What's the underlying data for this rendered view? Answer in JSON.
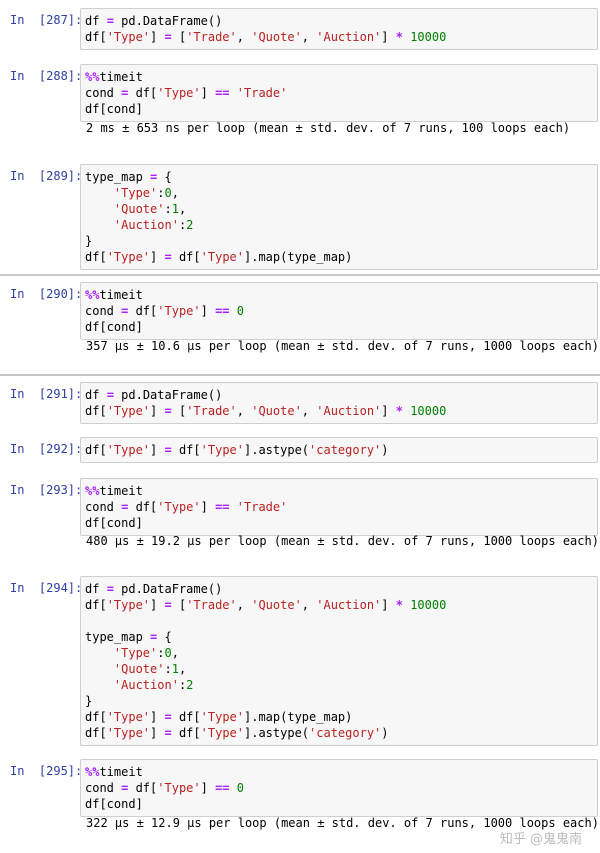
{
  "cells": [
    {
      "prompt_prefix": "In  ",
      "prompt_num": "[287]:",
      "lines": [
        [
          [
            "plain",
            "df "
          ],
          [
            "op",
            "="
          ],
          [
            "plain",
            " pd.DataFrame()"
          ]
        ],
        [
          [
            "plain",
            "df["
          ],
          [
            "str",
            "'Type'"
          ],
          [
            "plain",
            "] "
          ],
          [
            "op",
            "="
          ],
          [
            "plain",
            " ["
          ],
          [
            "str",
            "'Trade'"
          ],
          [
            "plain",
            ", "
          ],
          [
            "str",
            "'Quote'"
          ],
          [
            "plain",
            ", "
          ],
          [
            "str",
            "'Auction'"
          ],
          [
            "plain",
            "] "
          ],
          [
            "op",
            "*"
          ],
          [
            "plain",
            " "
          ],
          [
            "num",
            "10000"
          ]
        ]
      ]
    },
    {
      "prompt_prefix": "In  ",
      "prompt_num": "[288]:",
      "lines": [
        [
          [
            "kw-magic",
            "%%"
          ],
          [
            "plain",
            "timeit"
          ]
        ],
        [
          [
            "plain",
            "cond "
          ],
          [
            "op",
            "="
          ],
          [
            "plain",
            " df["
          ],
          [
            "str",
            "'Type'"
          ],
          [
            "plain",
            "] "
          ],
          [
            "op",
            "=="
          ],
          [
            "plain",
            " "
          ],
          [
            "str",
            "'Trade'"
          ]
        ],
        [
          [
            "plain",
            "df[cond]"
          ]
        ]
      ],
      "output": "2 ms ± 653 ns per loop (mean ± std. dev. of 7 runs, 100 loops each)"
    },
    {
      "prompt_prefix": "In  ",
      "prompt_num": "[289]:",
      "lines": [
        [
          [
            "plain",
            "type_map "
          ],
          [
            "op",
            "="
          ],
          [
            "plain",
            " {"
          ]
        ],
        [
          [
            "plain",
            "    "
          ],
          [
            "str",
            "'Type'"
          ],
          [
            "plain",
            ":"
          ],
          [
            "num",
            "0"
          ],
          [
            "plain",
            ","
          ]
        ],
        [
          [
            "plain",
            "    "
          ],
          [
            "str",
            "'Quote'"
          ],
          [
            "plain",
            ":"
          ],
          [
            "num",
            "1"
          ],
          [
            "plain",
            ","
          ]
        ],
        [
          [
            "plain",
            "    "
          ],
          [
            "str",
            "'Auction'"
          ],
          [
            "plain",
            ":"
          ],
          [
            "num",
            "2"
          ]
        ],
        [
          [
            "plain",
            "}"
          ]
        ],
        [
          [
            "plain",
            "df["
          ],
          [
            "str",
            "'Type'"
          ],
          [
            "plain",
            "] "
          ],
          [
            "op",
            "="
          ],
          [
            "plain",
            " df["
          ],
          [
            "str",
            "'Type'"
          ],
          [
            "plain",
            "].map(type_map)"
          ]
        ]
      ]
    },
    {
      "prompt_prefix": "In  ",
      "prompt_num": "[290]:",
      "lines": [
        [
          [
            "kw-magic",
            "%%"
          ],
          [
            "plain",
            "timeit"
          ]
        ],
        [
          [
            "plain",
            "cond "
          ],
          [
            "op",
            "="
          ],
          [
            "plain",
            " df["
          ],
          [
            "str",
            "'Type'"
          ],
          [
            "plain",
            "] "
          ],
          [
            "op",
            "=="
          ],
          [
            "plain",
            " "
          ],
          [
            "num",
            "0"
          ]
        ],
        [
          [
            "plain",
            "df[cond]"
          ]
        ]
      ],
      "output": "357 µs ± 10.6 µs per loop (mean ± std. dev. of 7 runs, 1000 loops each)"
    },
    {
      "prompt_prefix": "In  ",
      "prompt_num": "[291]:",
      "lines": [
        [
          [
            "plain",
            "df "
          ],
          [
            "op",
            "="
          ],
          [
            "plain",
            " pd.DataFrame()"
          ]
        ],
        [
          [
            "plain",
            "df["
          ],
          [
            "str",
            "'Type'"
          ],
          [
            "plain",
            "] "
          ],
          [
            "op",
            "="
          ],
          [
            "plain",
            " ["
          ],
          [
            "str",
            "'Trade'"
          ],
          [
            "plain",
            ", "
          ],
          [
            "str",
            "'Quote'"
          ],
          [
            "plain",
            ", "
          ],
          [
            "str",
            "'Auction'"
          ],
          [
            "plain",
            "] "
          ],
          [
            "op",
            "*"
          ],
          [
            "plain",
            " "
          ],
          [
            "num",
            "10000"
          ]
        ]
      ]
    },
    {
      "prompt_prefix": "In  ",
      "prompt_num": "[292]:",
      "lines": [
        [
          [
            "plain",
            "df["
          ],
          [
            "str",
            "'Type'"
          ],
          [
            "plain",
            "] "
          ],
          [
            "op",
            "="
          ],
          [
            "plain",
            " df["
          ],
          [
            "str",
            "'Type'"
          ],
          [
            "plain",
            "].astype("
          ],
          [
            "str",
            "'category'"
          ],
          [
            "plain",
            ")"
          ]
        ]
      ]
    },
    {
      "prompt_prefix": "In  ",
      "prompt_num": "[293]:",
      "lines": [
        [
          [
            "kw-magic",
            "%%"
          ],
          [
            "plain",
            "timeit"
          ]
        ],
        [
          [
            "plain",
            "cond "
          ],
          [
            "op",
            "="
          ],
          [
            "plain",
            " df["
          ],
          [
            "str",
            "'Type'"
          ],
          [
            "plain",
            "] "
          ],
          [
            "op",
            "=="
          ],
          [
            "plain",
            " "
          ],
          [
            "str",
            "'Trade'"
          ]
        ],
        [
          [
            "plain",
            "df[cond]"
          ]
        ]
      ],
      "output": "480 µs ± 19.2 µs per loop (mean ± std. dev. of 7 runs, 1000 loops each)"
    },
    {
      "prompt_prefix": "In  ",
      "prompt_num": "[294]:",
      "lines": [
        [
          [
            "plain",
            "df "
          ],
          [
            "op",
            "="
          ],
          [
            "plain",
            " pd.DataFrame()"
          ]
        ],
        [
          [
            "plain",
            "df["
          ],
          [
            "str",
            "'Type'"
          ],
          [
            "plain",
            "] "
          ],
          [
            "op",
            "="
          ],
          [
            "plain",
            " ["
          ],
          [
            "str",
            "'Trade'"
          ],
          [
            "plain",
            ", "
          ],
          [
            "str",
            "'Quote'"
          ],
          [
            "plain",
            ", "
          ],
          [
            "str",
            "'Auction'"
          ],
          [
            "plain",
            "] "
          ],
          [
            "op",
            "*"
          ],
          [
            "plain",
            " "
          ],
          [
            "num",
            "10000"
          ]
        ],
        [],
        [
          [
            "plain",
            "type_map "
          ],
          [
            "op",
            "="
          ],
          [
            "plain",
            " {"
          ]
        ],
        [
          [
            "plain",
            "    "
          ],
          [
            "str",
            "'Type'"
          ],
          [
            "plain",
            ":"
          ],
          [
            "num",
            "0"
          ],
          [
            "plain",
            ","
          ]
        ],
        [
          [
            "plain",
            "    "
          ],
          [
            "str",
            "'Quote'"
          ],
          [
            "plain",
            ":"
          ],
          [
            "num",
            "1"
          ],
          [
            "plain",
            ","
          ]
        ],
        [
          [
            "plain",
            "    "
          ],
          [
            "str",
            "'Auction'"
          ],
          [
            "plain",
            ":"
          ],
          [
            "num",
            "2"
          ]
        ],
        [
          [
            "plain",
            "}"
          ]
        ],
        [
          [
            "plain",
            "df["
          ],
          [
            "str",
            "'Type'"
          ],
          [
            "plain",
            "] "
          ],
          [
            "op",
            "="
          ],
          [
            "plain",
            " df["
          ],
          [
            "str",
            "'Type'"
          ],
          [
            "plain",
            "].map(type_map)"
          ]
        ],
        [
          [
            "plain",
            "df["
          ],
          [
            "str",
            "'Type'"
          ],
          [
            "plain",
            "] "
          ],
          [
            "op",
            "="
          ],
          [
            "plain",
            " df["
          ],
          [
            "str",
            "'Type'"
          ],
          [
            "plain",
            "].astype("
          ],
          [
            "str",
            "'category'"
          ],
          [
            "plain",
            ")"
          ]
        ]
      ]
    },
    {
      "prompt_prefix": "In  ",
      "prompt_num": "[295]:",
      "lines": [
        [
          [
            "kw-magic",
            "%%"
          ],
          [
            "plain",
            "timeit"
          ]
        ],
        [
          [
            "plain",
            "cond "
          ],
          [
            "op",
            "="
          ],
          [
            "plain",
            " df["
          ],
          [
            "str",
            "'Type'"
          ],
          [
            "plain",
            "] "
          ],
          [
            "op",
            "=="
          ],
          [
            "plain",
            " "
          ],
          [
            "num",
            "0"
          ]
        ],
        [
          [
            "plain",
            "df[cond]"
          ]
        ]
      ],
      "output": "322 µs ± 12.9 µs per loop (mean ± std. dev. of 7 runs, 1000 loops each)"
    }
  ],
  "watermark": "知乎 @鬼鬼南",
  "colors": {
    "prompt": "#303F9F",
    "string": "#BA2121",
    "number": "#008000",
    "operator": "#AA22FF",
    "cell_bg": "#f7f7f7",
    "cell_border": "#cfcfcf"
  }
}
